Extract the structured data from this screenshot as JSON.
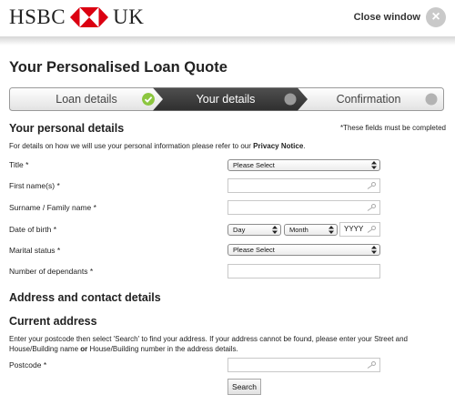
{
  "header": {
    "brand_left": "HSBC",
    "brand_right": "UK",
    "close_label": "Close window",
    "close_symbol": "×"
  },
  "page": {
    "title": "Your Personalised Loan Quote"
  },
  "steps": [
    {
      "label": "Loan details",
      "state": "done"
    },
    {
      "label": "Your details",
      "state": "active"
    },
    {
      "label": "Confirmation",
      "state": "pending"
    }
  ],
  "personal": {
    "title": "Your personal details",
    "required_note": "*These fields must be completed",
    "privacy_text": "For details on how we will use your personal information please refer to our ",
    "privacy_link": "Privacy Notice",
    "privacy_end": "."
  },
  "fields": {
    "title_label": "Title",
    "title_value": "Please Select",
    "first_name_label": "First name(s)",
    "surname_label": "Surname / Family name",
    "dob_label": "Date of birth",
    "dob_day": "Day",
    "dob_month": "Month",
    "dob_year_placeholder": "YYYY",
    "marital_label": "Marital status",
    "marital_value": "Please Select",
    "dependants_label": "Number of dependants",
    "required_marker": "*"
  },
  "address": {
    "section_title": "Address and contact details",
    "current_title": "Current address",
    "help_part1": "Enter your postcode then select 'Search' to find your address. If your address cannot be found, please enter your Street and House/Building name ",
    "help_or": "or",
    "help_part2": " House/Building number in the address details.",
    "postcode_label": "Postcode",
    "search_label": "Search"
  },
  "colors": {
    "brand_red": "#db0011",
    "step_active": "#3e3e3e",
    "step_done_check": "#8cc63f",
    "step_pending_dot": "#b3b3b3"
  }
}
